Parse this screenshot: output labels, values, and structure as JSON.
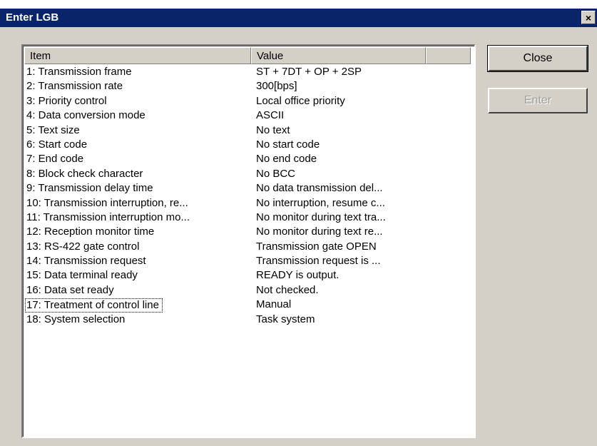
{
  "window": {
    "title": "Enter LGB",
    "close_glyph": "×"
  },
  "list": {
    "columns": [
      "Item",
      "Value"
    ],
    "rows": [
      {
        "item": "1: Transmission frame",
        "value": "ST + 7DT + OP + 2SP"
      },
      {
        "item": "2: Transmission rate",
        "value": "300[bps]"
      },
      {
        "item": "3: Priority control",
        "value": "Local office priority"
      },
      {
        "item": "4: Data conversion mode",
        "value": "ASCII"
      },
      {
        "item": "5: Text size",
        "value": "No text"
      },
      {
        "item": "6: Start code",
        "value": "No start code"
      },
      {
        "item": "7: End code",
        "value": "No end code"
      },
      {
        "item": "8: Block check character",
        "value": "No BCC"
      },
      {
        "item": "9: Transmission delay time",
        "value": "No data transmission del..."
      },
      {
        "item": "10: Transmission interruption, re...",
        "value": "No interruption, resume c..."
      },
      {
        "item": "11: Transmission interruption mo...",
        "value": "No monitor during text tra..."
      },
      {
        "item": "12: Reception monitor time",
        "value": "No monitor during text re..."
      },
      {
        "item": "13: RS-422 gate control",
        "value": "Transmission gate OPEN"
      },
      {
        "item": "14: Transmission request",
        "value": "Transmission request is ..."
      },
      {
        "item": "15: Data terminal ready",
        "value": "READY is output."
      },
      {
        "item": "16: Data set ready",
        "value": "Not checked."
      },
      {
        "item": "17: Treatment of control line",
        "value": "Manual"
      },
      {
        "item": "18: System selection",
        "value": "Task system"
      }
    ]
  },
  "buttons": {
    "close_label": "Close",
    "enter_label": "Enter"
  }
}
